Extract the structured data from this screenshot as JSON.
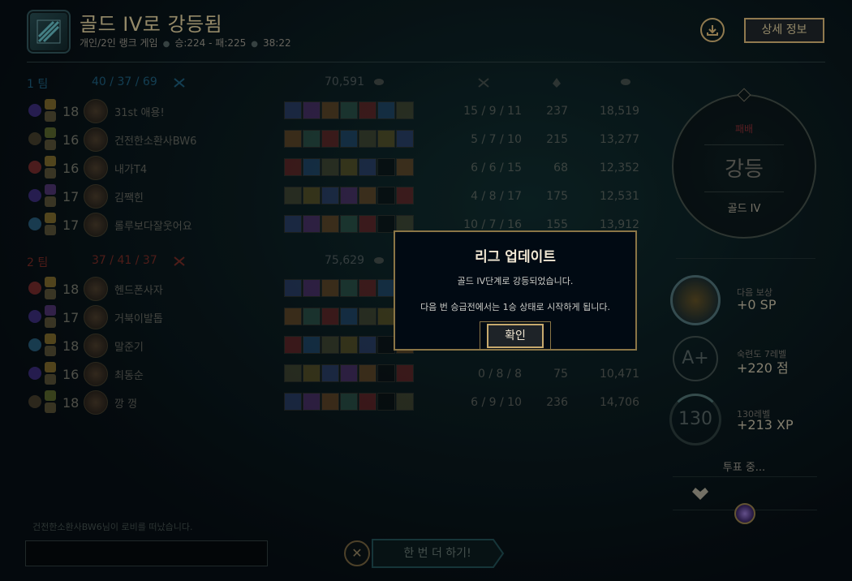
{
  "header": {
    "title": "골드 IV로 강등됨",
    "queue": "개인/2인 랭크 게임",
    "record": "승:224 - 패:225",
    "duration": "38:22",
    "detail_button": "상세 정보",
    "download_icon": "download-icon"
  },
  "team1": {
    "name": "1 팀",
    "kills": "40",
    "deaths": "37",
    "assists": "69",
    "gold": "70,591",
    "color": "#2c8fbf",
    "players": [
      {
        "level": "18",
        "name": "31st 애용!",
        "k": "15",
        "d": "9",
        "a": "11",
        "cs": "237",
        "gold": "18,519"
      },
      {
        "level": "16",
        "name": "건전한소환사BW6",
        "k": "5",
        "d": "7",
        "a": "10",
        "cs": "215",
        "gold": "13,277"
      },
      {
        "level": "16",
        "name": "내가T4",
        "k": "6",
        "d": "6",
        "a": "15",
        "cs": "68",
        "gold": "12,352"
      },
      {
        "level": "17",
        "name": "김짹힌",
        "k": "4",
        "d": "8",
        "a": "17",
        "cs": "175",
        "gold": "12,531"
      },
      {
        "level": "17",
        "name": "롤루보다잘웃어요",
        "k": "10",
        "d": "7",
        "a": "16",
        "cs": "155",
        "gold": "13,912"
      }
    ]
  },
  "team2": {
    "name": "2 팀",
    "kills": "37",
    "deaths": "41",
    "assists": "37",
    "gold": "75,629",
    "color": "#c0392b",
    "players": [
      {
        "level": "18",
        "name": "헨드폰사자",
        "k": "",
        "d": "",
        "a": "",
        "cs": "",
        "gold": ""
      },
      {
        "level": "17",
        "name": "거북이발톱",
        "k": "",
        "d": "",
        "a": "",
        "cs": "",
        "gold": ""
      },
      {
        "level": "18",
        "name": "말준기",
        "k": "",
        "d": "",
        "a": "",
        "cs": "",
        "gold": ""
      },
      {
        "level": "16",
        "name": "최동순",
        "k": "0",
        "d": "8",
        "a": "8",
        "cs": "75",
        "gold": "10,471"
      },
      {
        "level": "18",
        "name": "깡 껑",
        "k": "6",
        "d": "9",
        "a": "10",
        "cs": "236",
        "gold": "14,706"
      }
    ]
  },
  "rank": {
    "result_label": "패배",
    "result": "강등",
    "tier": "골드 IV"
  },
  "rewards": [
    {
      "label": "다음 보상",
      "value": "+0 SP"
    },
    {
      "label": "숙련도 7레벨",
      "value": "+220 점",
      "badge": "A+"
    },
    {
      "label": "130레벨",
      "value": "+213 XP",
      "badge": "130"
    }
  ],
  "vote": {
    "label": "투표 중..."
  },
  "chat": {
    "log": "건전한소환사BW6님이 로비를 떠났습니다."
  },
  "play_again": {
    "label": "한 번 더 하기!"
  },
  "modal": {
    "title": "리그 업데이트",
    "message1": "골드 IV단계로 강등되었습니다.",
    "message2": "다음 번 승급전에서는 1승 상태로 시작하게 됩니다.",
    "ok": "확인"
  }
}
